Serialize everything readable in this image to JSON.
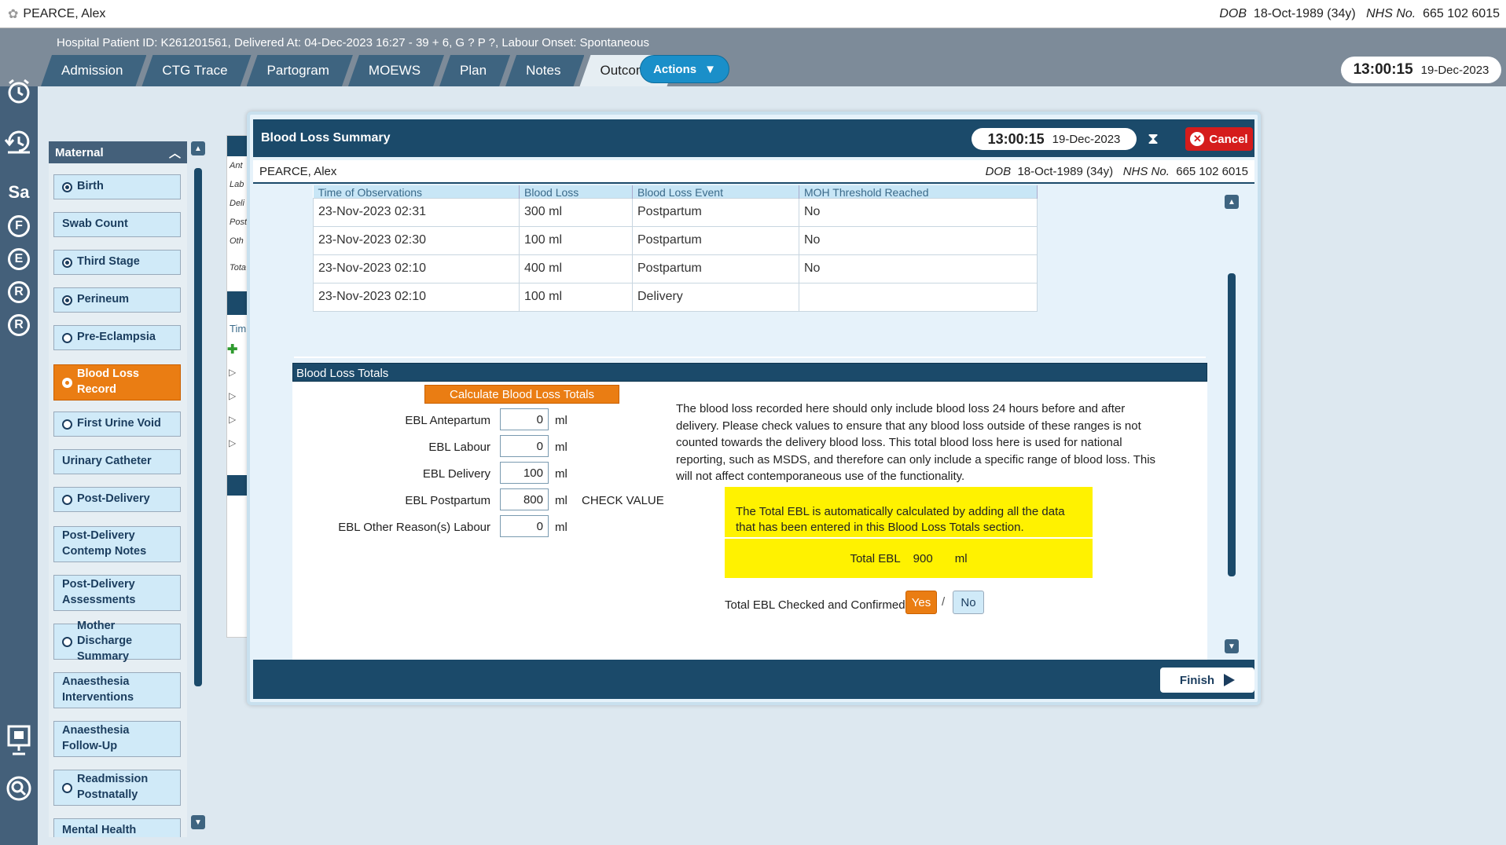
{
  "topbar": {
    "patient_name": "PEARCE, Alex",
    "dob_label": "DOB",
    "dob_value": "18-Oct-1989 (34y)",
    "nhs_label": "NHS No.",
    "nhs_value": "665 102 6015"
  },
  "header": {
    "info": "Hospital Patient ID: K261201561, Delivered At: 04-Dec-2023 16:27 - 39 + 6, G ? P ?,   Labour Onset: Spontaneous",
    "tabs": [
      {
        "label": "Admission"
      },
      {
        "label": "CTG Trace"
      },
      {
        "label": "Partogram"
      },
      {
        "label": "MOEWS"
      },
      {
        "label": "Plan"
      },
      {
        "label": "Notes"
      },
      {
        "label": "Outcome"
      }
    ],
    "active_tab": "Outcome",
    "actions_label": "Actions",
    "clock_time": "13:00:15",
    "clock_date": "19-Dec-2023"
  },
  "rail": {
    "letters": [
      "Sa",
      "F",
      "E",
      "R",
      "R"
    ]
  },
  "maternal": {
    "title": "Maternal",
    "items": [
      {
        "label": "Birth",
        "radio": "on"
      },
      {
        "label": "Swab Count",
        "radio": "none"
      },
      {
        "label": "Third Stage",
        "radio": "on"
      },
      {
        "label": "Perineum",
        "radio": "on"
      },
      {
        "label": "Pre-Eclampsia",
        "radio": "off"
      },
      {
        "label": "Blood Loss Record",
        "radio": "on",
        "active": true
      },
      {
        "label": "First Urine Void",
        "radio": "off"
      },
      {
        "label": "Urinary Catheter",
        "radio": "none"
      },
      {
        "label": "Post-Delivery",
        "radio": "off"
      },
      {
        "label": "Post-Delivery Contemp Notes",
        "radio": "none"
      },
      {
        "label": "Post-Delivery Assessments",
        "radio": "none"
      },
      {
        "label": "Mother Discharge Summary",
        "radio": "off"
      },
      {
        "label": "Anaesthesia Interventions",
        "radio": "none"
      },
      {
        "label": "Anaesthesia Follow-Up",
        "radio": "none"
      },
      {
        "label": "Readmission Postnatally",
        "radio": "off"
      },
      {
        "label": "Mental Health",
        "radio": "none"
      }
    ]
  },
  "behind": {
    "labels": [
      "Ant",
      "Lab",
      "Deli",
      "Post",
      "Oth",
      "Tota",
      "Tim"
    ]
  },
  "dialog": {
    "title": "Blood Loss Summary",
    "clock_time": "13:00:15",
    "clock_date": "19-Dec-2023",
    "cancel_label": "Cancel",
    "patient_name": "PEARCE, Alex",
    "dob_label": "DOB",
    "dob_value": "18-Oct-1989 (34y)",
    "nhs_label": "NHS No.",
    "nhs_value": "665 102 6015",
    "table": {
      "headers": [
        "Time of Observations",
        "Blood Loss",
        "Blood Loss Event",
        "MOH Threshold Reached"
      ],
      "rows": [
        [
          "23-Nov-2023 02:31",
          "300 ml",
          "Postpartum",
          "No"
        ],
        [
          "23-Nov-2023 02:30",
          "100 ml",
          "Postpartum",
          "No"
        ],
        [
          "23-Nov-2023 02:10",
          "400 ml",
          "Postpartum",
          "No"
        ],
        [
          "23-Nov-2023 02:10",
          "100 ml",
          "Delivery",
          ""
        ]
      ]
    },
    "totals": {
      "section_title": "Blood Loss Totals",
      "calc_label": "Calculate Blood Loss Totals",
      "unit": "ml",
      "fields": [
        {
          "label": "EBL Antepartum",
          "value": "0"
        },
        {
          "label": "EBL Labour",
          "value": "0"
        },
        {
          "label": "EBL Delivery",
          "value": "100"
        },
        {
          "label": "EBL Postpartum",
          "value": "800",
          "flag": "CHECK VALUE"
        },
        {
          "label": "EBL Other Reason(s) Labour",
          "value": "0"
        }
      ],
      "note": "The blood loss recorded here should only include blood loss 24 hours before and after delivery. Please check values to ensure that any blood loss outside of these ranges is not counted towards the delivery blood loss. This total blood loss here is used for national reporting, such as MSDS, and therefore can only include a specific range of blood loss. This will not affect contemporaneous use of the functionality.",
      "auto_calc_text": "The Total EBL is automatically calculated by adding all the data that has been entered in this Blood Loss Totals section.",
      "total_label": "Total EBL",
      "total_value": "900",
      "total_unit": "ml",
      "confirm_label": "Total EBL Checked and Confirmed",
      "yes_label": "Yes",
      "separator": "/",
      "no_label": "No",
      "confirm_selected": "Yes"
    },
    "finish_label": "Finish"
  },
  "colors": {
    "header_bg": "#7d8b99",
    "tab_bg": "#3e6480",
    "dialog_bar": "#1b4a6a",
    "accent_orange": "#ea7d13",
    "highlight_yellow": "#fff200",
    "cancel_red": "#d51c1c",
    "actions_blue": "#1a8fc9"
  }
}
